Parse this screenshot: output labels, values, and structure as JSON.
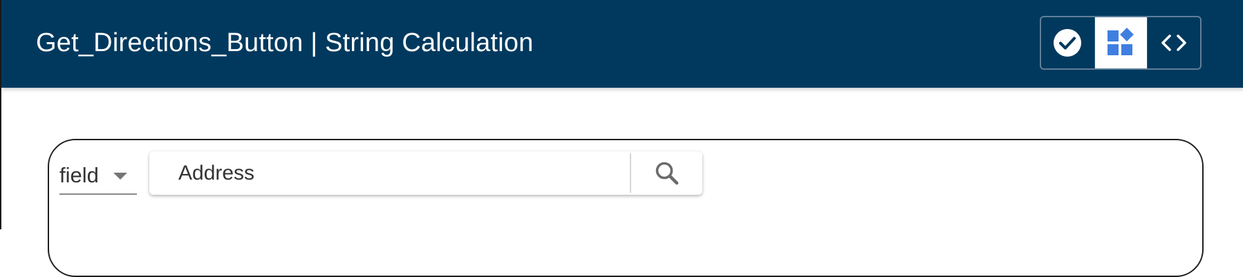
{
  "header": {
    "title": "Get_Directions_Button | String Calculation",
    "background_color": "#01395e",
    "view_toggle": [
      {
        "icon": "check-circle-icon",
        "active": false
      },
      {
        "icon": "widgets-icon",
        "active": true
      },
      {
        "icon": "code-icon",
        "active": false
      }
    ]
  },
  "search": {
    "field_select_value": "field",
    "input_value": "Address",
    "search_icon": "search-icon"
  },
  "colors": {
    "accent": "#3f7fe0",
    "header": "#01395e"
  }
}
